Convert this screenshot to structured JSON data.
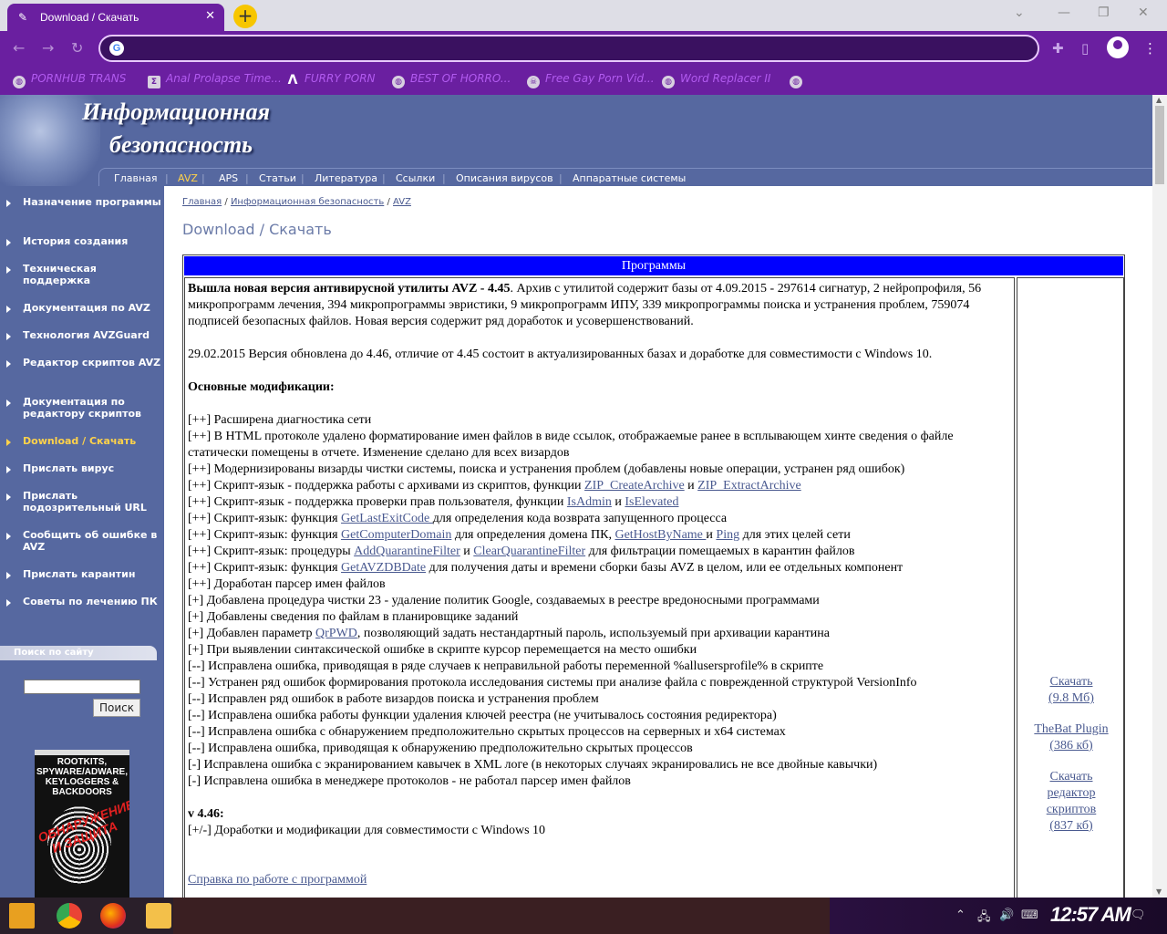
{
  "browser": {
    "tab_title": "Download / Скачать",
    "tab_close": "✕",
    "new_tab": "+",
    "address_value": "",
    "bookmarks": [
      {
        "label": "PORNHUB TRANS",
        "icon": "globe-icon"
      },
      {
        "label": "Anal Prolapse Time...",
        "icon": "bracket-icon"
      },
      {
        "label": "FURRY PORN",
        "icon": "lambda-icon"
      },
      {
        "label": "BEST OF HORRO...",
        "icon": "globe-icon"
      },
      {
        "label": "Free Gay Porn Vid...",
        "icon": "skull-icon"
      },
      {
        "label": "Word Replacer II",
        "icon": "globe-icon"
      }
    ]
  },
  "site": {
    "title_line1": "Информационная",
    "title_line2": "безопасность",
    "menu": [
      "Главная",
      "AVZ",
      "APS",
      "Статьи",
      "Литература",
      "Ссылки",
      "Описания вирусов",
      "Аппаратные системы"
    ],
    "active_menu": "AVZ"
  },
  "sidebar": {
    "items": [
      "Назначение программы",
      "История создания",
      "Техническая поддержка",
      "Документация по AVZ",
      "Технология AVZGuard",
      "Редактор скриптов AVZ",
      "Документация по редактору скриптов",
      "Download / Скачать",
      "Прислать вирус",
      "Прислать подозрительный URL",
      "Сообщить об ошибке в AVZ",
      "Прислать карантин",
      "Советы по лечению ПК"
    ],
    "active_item": "Download / Скачать",
    "search_label": "Поиск по сайту",
    "search_value": "",
    "search_button": "Поиск",
    "book": {
      "title": "ROOTKITS, SPYWARE/ADWARE, KEYLOGGERS & BACKDOORS",
      "subtitle": "ОБНАРУЖЕНИЕ И ЗАЩИТА"
    }
  },
  "content": {
    "breadcrumb": [
      "Главная",
      "Информационная безопасность",
      "AVZ"
    ],
    "breadcrumb_sep": "/",
    "page_title": "Download / Скачать",
    "table_header": "Программы",
    "intro_bold": "Вышла новая версия антивирусной утилиты AVZ - 4.45",
    "intro_rest": ". Архив с утилитой содержит базы от 4.09.2015 - 297614 сигнатур, 2 нейропрофиля, 56 микропрограмм лечения, 394 микропрограммы эвристики, 9 микропрограмм ИПУ, 339 микропрограммы поиска и устранения проблем, 759074 подписей безопасных файлов. Новая версия содержит ряд доработок и усовершенствований.",
    "update_note": "29.02.2015 Версия обновлена до 4.46, отличие от 4.45 состоит в актуализированных базах и доработке для совместимости с Windows 10.",
    "mods_heading": "Основные модификации:",
    "lines": [
      "[++] Расширена диагностика сети",
      "[++] В HTML протоколе удалено форматирование имен файлов в виде ссылок, отображаемые ранее в всплывающем хинте сведения о файле статически помещены в отчете. Изменение сделано для всех визардов",
      "[++] Модернизированы визарды чистки системы, поиска и устранения проблем (добавлены новые операции, устранен ряд ошибок)",
      {
        "parts": [
          "[++] Скрипт-язык - поддержка работы с архивами из скриптов, функции ",
          {
            "link": "ZIP_CreateArchive"
          },
          " и ",
          {
            "link": "ZIP_ExtractArchive"
          }
        ]
      },
      {
        "parts": [
          "[++] Скрипт-язык - поддержка проверки прав пользователя, функции ",
          {
            "link": "IsAdmin"
          },
          " и ",
          {
            "link": "IsElevated"
          }
        ]
      },
      {
        "parts": [
          "[++] Скрипт-язык: функция ",
          {
            "link": "GetLastExitCode "
          },
          "для определения кода возврата запущенного процесса"
        ]
      },
      {
        "parts": [
          "[++] Скрипт-язык: функция ",
          {
            "link": "GetComputerDomain"
          },
          " для определения домена ПК, ",
          {
            "link": "GetHostByName "
          },
          "и ",
          {
            "link": "Ping"
          },
          " для этих целей сети"
        ]
      },
      {
        "parts": [
          "[++] Скрипт-язык: процедуры ",
          {
            "link": "AddQuarantineFilter"
          },
          " и ",
          {
            "link": "ClearQuarantineFilter"
          },
          " для фильтрации помещаемых в карантин файлов"
        ]
      },
      {
        "parts": [
          "[++] Скрипт-язык: функция ",
          {
            "link": "GetAVZDBDate"
          },
          " для получения даты и времени сборки базы AVZ в целом, или ее отдельных компонент"
        ]
      },
      "[++] Доработан парсер имен файлов",
      "[+] Добавлена процедура чистки 23 - удаление политик Google, создаваемых в реестре вредоносными программами",
      "[+] Добавлены сведения по файлам в планировщике заданий",
      {
        "parts": [
          "[+] Добавлен параметр ",
          {
            "link": "QrPWD"
          },
          ", позволяющий задать нестандартный пароль, используемый при архивации карантина"
        ]
      },
      "[+] При выявлении синтаксической ошибке в скрипте курсор перемещается на место ошибки",
      "[--] Исправлена ошибка, приводящая в ряде случаев к неправильной работы переменной %allusersprofile% в скрипте",
      "[--] Устранен ряд ошибок формирования протокола исследования системы при анализе файла с поврежденной структурой VersionInfo",
      "[--] Исправлен ряд ошибок в работе визардов поиска и устранения проблем",
      "[--] Исправлена ошибка работы функции удаления ключей реестра (не учитывалось состояния редиректора)",
      "[--] Исправлена ошибка с обнаружением предположительно скрытых процессов на серверных и x64 системах",
      "[--] Исправлена ошибка, приводящая к обнаружению предположительно скрытых процессов",
      "[-] Исправлена ошибка с экранированием кавычек в XML логе (в некоторых случаях экранировались не все двойные кавычки)",
      "[-] Исправлена ошибка в менеджере протоколов - не работал парсер имен файлов"
    ],
    "v446_heading": "v 4.46:",
    "v446_line": "[+/-] Доработки и модификации для совместимости с Windows 10",
    "help_link": "Справка по работе с программой",
    "downloads": [
      {
        "line1": "Скачать",
        "line2": "(9.8 Мб)"
      },
      {
        "line1": "TheBat Plugin",
        "line2": "(386 кб)"
      },
      {
        "line1": "Скачать",
        "line2": "редактор",
        "line3": "скриптов",
        "line4": "(837 кб)"
      }
    ]
  },
  "taskbar": {
    "clock": "12:57 AM"
  },
  "colors": {
    "browser_accent": "#6a1fa0",
    "site_blue": "#5668a0",
    "table_header": "#0000ff",
    "active_link": "#ffd24a"
  }
}
